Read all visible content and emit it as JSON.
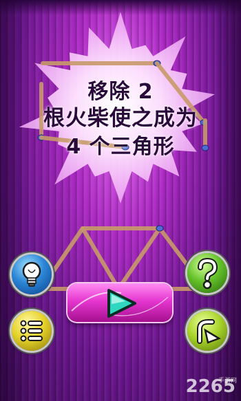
{
  "title": {
    "line1": "移除 2",
    "line2": "根火柴使之成为",
    "line3": "4 个三角形"
  },
  "buttons": {
    "hint": "lightbulb-icon",
    "help": "question-mark-icon",
    "menu": "list-menu-icon",
    "play": "play-icon",
    "share": "share-arrow-icon"
  },
  "colors": {
    "background": "#8a1fb0",
    "play_button": "#e637d0",
    "match_head": "#4f6bd8",
    "match_stick": "#c89a6a"
  },
  "watermark": {
    "logo": "2265",
    "sub": "手游网"
  }
}
